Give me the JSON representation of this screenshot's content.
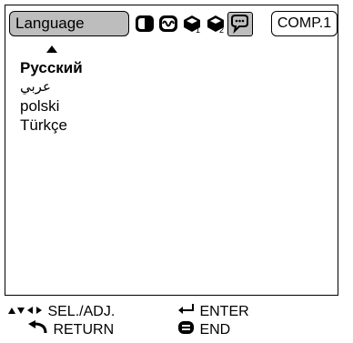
{
  "header": {
    "language_tab": "Language",
    "input_label": "COMP.1",
    "menu_icons": [
      "picture-adjust-icon",
      "signal-adjust-icon",
      "options-1-icon",
      "options-2-icon",
      "language-icon"
    ]
  },
  "language_list": {
    "items": [
      "Русский",
      "عربي",
      "polski",
      "Türkçe"
    ],
    "current": "Русский"
  },
  "footer": {
    "select_adjust": "SEL./ADJ.",
    "enter": "ENTER",
    "return": "RETURN",
    "end": "END"
  },
  "colors": {
    "highlight_gray": "#bdbdbd",
    "frame": "#000000"
  }
}
